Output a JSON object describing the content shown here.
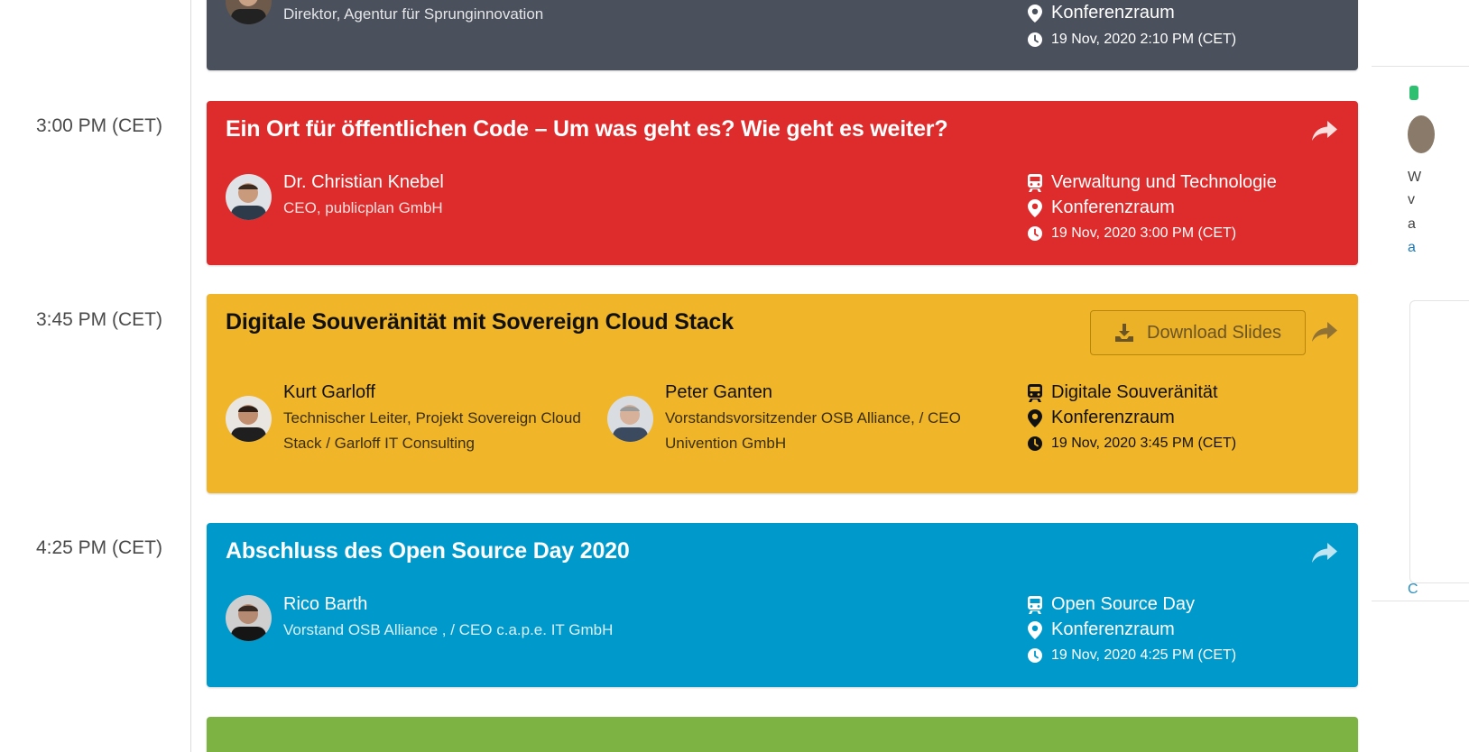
{
  "times": [
    "3:00 PM (CET)",
    "3:45 PM (CET)",
    "4:25 PM (CET)"
  ],
  "sessions": [
    {
      "title": "",
      "speakers": [
        {
          "name": "",
          "role": "Direktor, Agentur für Sprunginnovation"
        }
      ],
      "track": "",
      "room": "Konferenzraum",
      "datetime": "19 Nov, 2020 2:10 PM (CET)"
    },
    {
      "title": "Ein Ort für öffentlichen Code – Um was geht es? Wie geht es weiter?",
      "speakers": [
        {
          "name": "Dr. Christian Knebel",
          "role": "CEO, publicplan GmbH"
        }
      ],
      "track": "Verwaltung und Technologie",
      "room": "Konferenzraum",
      "datetime": "19 Nov, 2020 3:00 PM (CET)"
    },
    {
      "title": "Digitale Souveränität mit Sovereign Cloud Stack",
      "download_label": "Download Slides",
      "speakers": [
        {
          "name": "Kurt Garloff",
          "role": "Technischer Leiter, Projekt Sovereign Cloud Stack / Garloff IT Consulting"
        },
        {
          "name": "Peter Ganten",
          "role": "Vorstandsvorsitzender OSB Alliance, / CEO Univention GmbH"
        }
      ],
      "track": "Digitale Souveränität",
      "room": "Konferenzraum",
      "datetime": "19 Nov, 2020 3:45 PM (CET)"
    },
    {
      "title": "Abschluss des Open Source Day 2020",
      "speakers": [
        {
          "name": "Rico Barth",
          "role": "Vorstand OSB Alliance , / CEO c.a.p.e. IT GmbH"
        }
      ],
      "track": "Open Source Day",
      "room": "Konferenzraum",
      "datetime": "19 Nov, 2020 4:25 PM (CET)"
    }
  ],
  "colors": {
    "dark_card": "#4a505c",
    "red_card": "#de2b2b",
    "yellow_card": "#f0b528",
    "blue_card": "#0099cc",
    "green_card": "#7cb342"
  },
  "right_panel": {
    "fragments": [
      "W",
      "v",
      "a",
      "a",
      "C"
    ]
  }
}
